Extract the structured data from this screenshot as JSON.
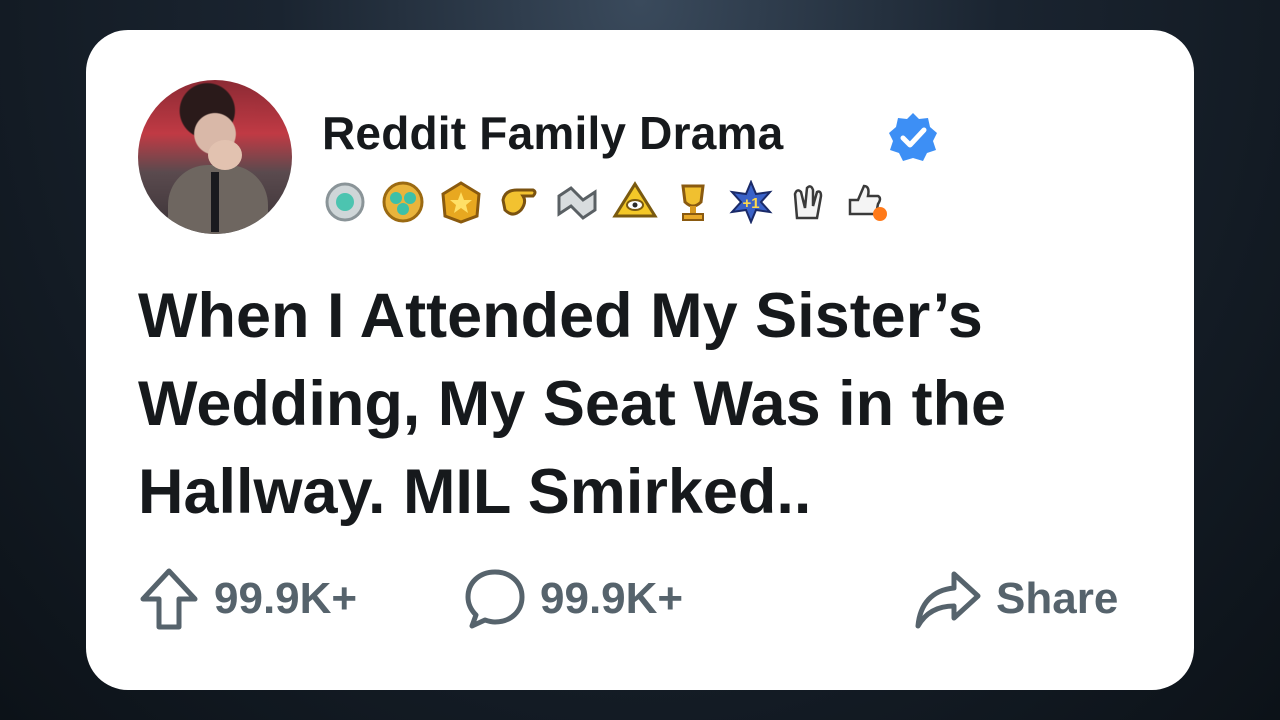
{
  "post": {
    "channel_name": "Reddit Family Drama",
    "verified_icon": "verified-check-badge",
    "awards": [
      "silver-award",
      "helpful-award",
      "gold-star-award",
      "pointing-hand-award",
      "handshake-award",
      "eye-pyramid-award",
      "trophy-award",
      "plus-one-award",
      "clapping-hands-award",
      "thumbs-up-award"
    ],
    "title": "When I Attended My Sister’s Wedding, My Seat Was in the Hallway. MIL Smirked.."
  },
  "actions": {
    "upvote_count": "99.9K+",
    "comment_count": "99.9K+",
    "share_label": "Share"
  },
  "colors": {
    "card": "#ffffff",
    "text": "#16191c",
    "muted": "#56636c",
    "verified": "#3d8ff5"
  }
}
